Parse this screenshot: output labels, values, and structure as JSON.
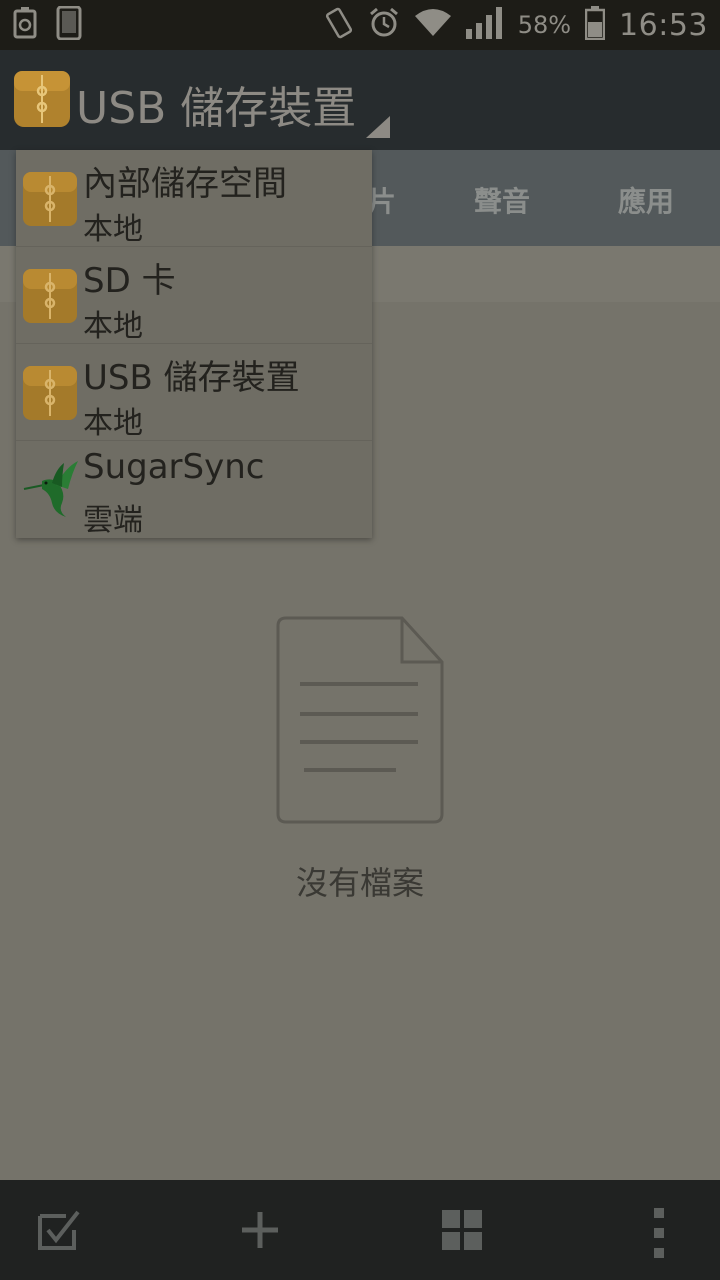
{
  "status_bar": {
    "battery_percent": "58%",
    "time": "16:53",
    "icons": [
      "battery-saver-icon",
      "phone-screen-icon",
      "vibrate-icon",
      "alarm-icon",
      "wifi-icon",
      "signal-icon",
      "battery-icon"
    ]
  },
  "app_bar": {
    "title": "USB 儲存裝置",
    "logo_icon": "folder-zip-icon"
  },
  "tabs": [
    {
      "label": "片"
    },
    {
      "label": "聲音"
    },
    {
      "label": "應用"
    }
  ],
  "dropdown": {
    "items": [
      {
        "name": "內部儲存空間",
        "sub": "本地",
        "icon": "folder-zip-icon"
      },
      {
        "name": "SD 卡",
        "sub": "本地",
        "icon": "folder-zip-icon"
      },
      {
        "name": "USB 儲存裝置",
        "sub": "本地",
        "icon": "folder-zip-icon"
      },
      {
        "name": "SugarSync",
        "sub": "雲端",
        "icon": "hummingbird-icon"
      }
    ]
  },
  "empty_state": {
    "message": "沒有檔案",
    "icon": "document-icon"
  },
  "bottom_bar": {
    "tools": [
      "select-checkbox-icon",
      "add-icon",
      "grid-view-icon",
      "more-vert-icon"
    ]
  },
  "colors": {
    "accent_folder": "#b0822d",
    "dim_overlay_bg": "#75736a",
    "hummingbird_green": "#1f6b2a"
  }
}
